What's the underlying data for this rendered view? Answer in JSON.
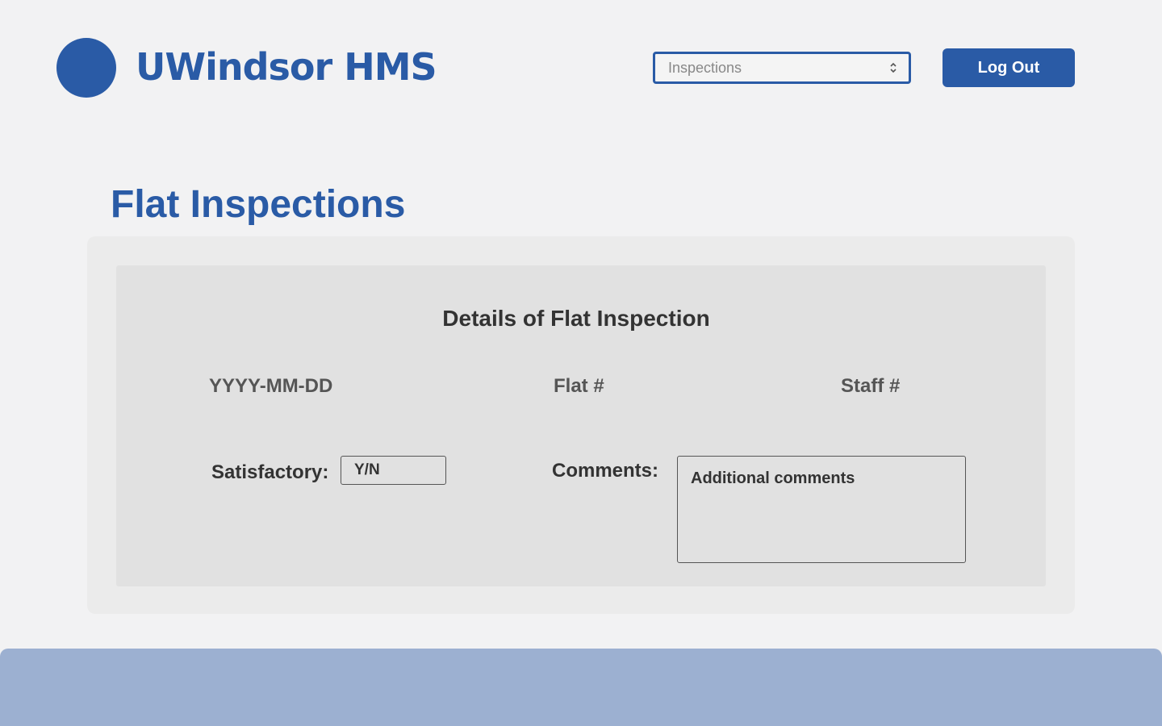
{
  "header": {
    "app_title": "UWindsor HMS",
    "nav_select": {
      "value": "Inspections"
    },
    "logout_label": "Log Out"
  },
  "page": {
    "title": "Flat Inspections"
  },
  "details": {
    "title": "Details of Flat Inspection",
    "date_label": "YYYY-MM-DD",
    "flat_label": "Flat #",
    "staff_label": "Staff #",
    "satisfactory_label": "Satisfactory:",
    "satisfactory_placeholder": "Y/N",
    "comments_label": "Comments:",
    "comments_placeholder": "Additional comments"
  },
  "colors": {
    "brand": "#2a5ba6",
    "footer": "#9cb0d1",
    "background": "#f2f2f3"
  },
  "icons": {
    "logo": "logo-circle-icon",
    "select_arrows": "chevron-up-down-icon"
  }
}
